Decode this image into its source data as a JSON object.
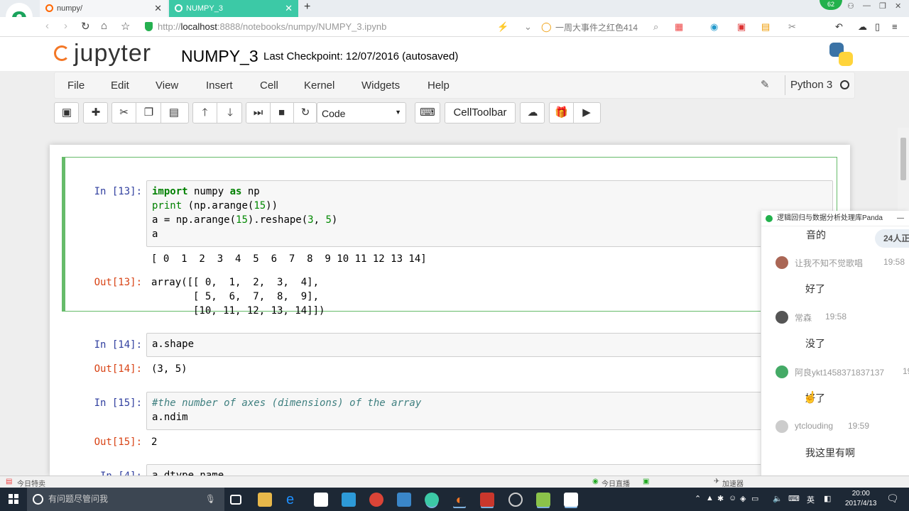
{
  "browser": {
    "tabs": [
      {
        "label": "numpy/"
      },
      {
        "label": "NUMPY_3"
      }
    ],
    "new_tab": "+",
    "badge": "62",
    "url_prefix": "http://",
    "url_host": "localhost",
    "url_rest": ":8888/notebooks/numpy/NUMPY_3.ipynb",
    "hot_search": "一周大事件之红色414"
  },
  "jupyter": {
    "logo_text": "jupyter",
    "notebook_name": "NUMPY_3",
    "checkpoint": "Last Checkpoint: 12/07/2016 (autosaved)",
    "menu": [
      "File",
      "Edit",
      "View",
      "Insert",
      "Cell",
      "Kernel",
      "Widgets",
      "Help"
    ],
    "kernel_name": "Python 3",
    "cell_type": "Code",
    "celltoolbar": "CellToolbar"
  },
  "cells": [
    {
      "in_prompt": "In [13]:",
      "code_lines": [
        "import numpy as np",
        "print (np.arange(15))",
        "a = np.arange(15).reshape(3, 5)",
        "a"
      ],
      "stdout": "[ 0  1  2  3  4  5  6  7  8  9 10 11 12 13 14]",
      "out_prompt": "Out[13]:",
      "output": "array([[ 0,  1,  2,  3,  4],\n       [ 5,  6,  7,  8,  9],\n       [10, 11, 12, 13, 14]])"
    },
    {
      "in_prompt": "In [14]:",
      "code": "a.shape",
      "out_prompt": "Out[14]:",
      "output": "(3, 5)"
    },
    {
      "in_prompt": "In [15]:",
      "comment": "#the number of axes (dimensions) of the array",
      "code": "a.ndim",
      "out_prompt": "Out[15]:",
      "output": "2"
    },
    {
      "in_prompt": "In [4]:",
      "code": "a.dtype.name"
    }
  ],
  "chat": {
    "title": "逻辑回归与数据分析处理库Panda",
    "minimize": "—",
    "viewer_count": "24人正",
    "messages": [
      {
        "text": "音的"
      },
      {
        "user": "让我不知不觉歌唱",
        "time": "19:58",
        "text": "好了"
      },
      {
        "user": "常森",
        "time": "19:58",
        "text": "没了"
      },
      {
        "user": "阿良ykt1458371837137",
        "time": "19",
        "text": "好了"
      },
      {
        "user": "ytclouding",
        "time": "19:59",
        "text": "我这里有啊"
      }
    ]
  },
  "statusbar": {
    "left": "今日特卖",
    "live": "今日直播",
    "accel": "加速器"
  },
  "taskbar": {
    "search_placeholder": "有问题尽管问我",
    "ime": "英",
    "time": "20:00",
    "date": "2017/4/13"
  }
}
